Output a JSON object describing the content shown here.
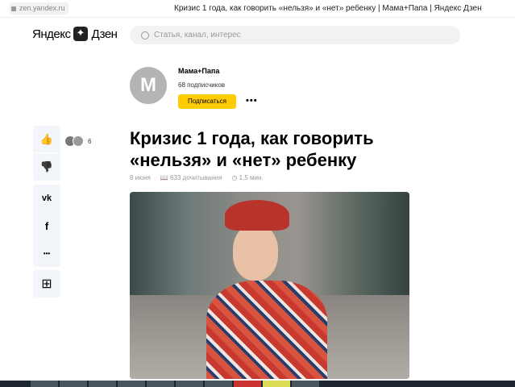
{
  "browser": {
    "url": "zen.yandex.ru",
    "title": "Кризис 1 года, как говорить «нельзя» и «нет» ребенку | Мама+Папа | Яндекс Дзен"
  },
  "header": {
    "logo_left": "Яндекс",
    "logo_right": "Дзен",
    "search_placeholder": "Статья, канал, интерес"
  },
  "channel": {
    "initial": "M",
    "name": "Мама+Папа",
    "subscribers": "68 подписчиков",
    "subscribe_label": "Подписаться",
    "more": "•••"
  },
  "sidebar": {
    "like": "👍",
    "dislike": "👎",
    "vk": "vk",
    "facebook": "f",
    "more": "•••",
    "save": "⊞",
    "likes_count": "6"
  },
  "article": {
    "title": "Кризис 1 года, как говорить «нельзя» и «нет» ребенку",
    "date": "8 июня",
    "reads": "633 дочитывания",
    "read_time": "1,5 мин."
  },
  "colors": {
    "accent": "#ffcc00",
    "like": "#1a73e8"
  }
}
